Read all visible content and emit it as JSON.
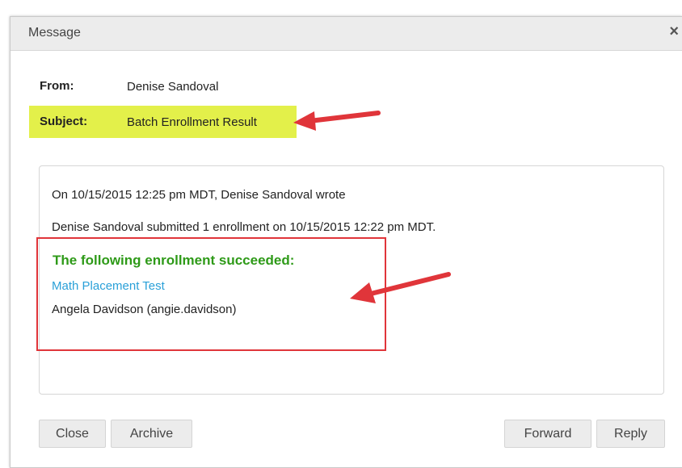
{
  "dialog": {
    "title": "Message",
    "close_glyph": "×"
  },
  "header": {
    "from_label": "From:",
    "from_value": "Denise Sandoval",
    "subject_label": "Subject:",
    "subject_value": "Batch Enrollment Result"
  },
  "message": {
    "wrote_line": "On 10/15/2015 12:25 pm MDT, Denise Sandoval wrote",
    "submitted_line": "Denise Sandoval submitted 1 enrollment on 10/15/2015 12:22 pm MDT.",
    "success_heading": "The following enrollment succeeded:",
    "course_link": "Math Placement Test",
    "person": "Angela Davidson (angie.davidson)"
  },
  "buttons": {
    "close": "Close",
    "archive": "Archive",
    "forward": "Forward",
    "reply": "Reply"
  },
  "colors": {
    "highlight": "#e3f04a",
    "annotation_red": "#e0353a",
    "success_green": "#2e9a18",
    "link_blue": "#2aa0d8"
  },
  "icons": {
    "close": "close-icon",
    "annotation": "annotation-arrow-icon"
  }
}
